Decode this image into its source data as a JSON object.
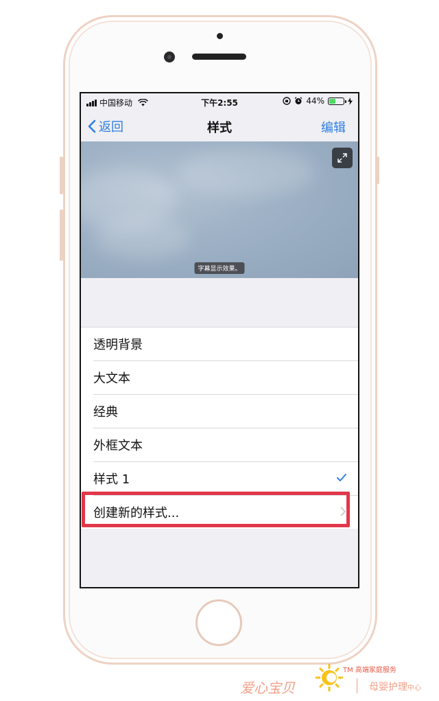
{
  "status_bar": {
    "carrier": "中国移动",
    "time": "下午2:55",
    "battery_percent": "44%",
    "battery_level": 0.44,
    "icons": [
      "signal-icon",
      "wifi-icon",
      "orientation-lock-icon",
      "alarm-icon",
      "battery-icon",
      "charging-icon"
    ]
  },
  "nav": {
    "back_label": "返回",
    "title": "样式",
    "edit_label": "编辑"
  },
  "preview": {
    "caption": "字幕显示效果。",
    "expand_icon": "expand-icon"
  },
  "style_list": {
    "items": [
      {
        "label": "透明背景",
        "selected": false
      },
      {
        "label": "大文本",
        "selected": false
      },
      {
        "label": "经典",
        "selected": false
      },
      {
        "label": "外框文本",
        "selected": false
      },
      {
        "label": "样式 1",
        "selected": true
      },
      {
        "label": "创建新的样式...",
        "selected": false,
        "disclosure": true
      }
    ]
  },
  "colors": {
    "accent": "#2f7fe0",
    "highlight": "#e2374a",
    "checkmark": "#2f7fe0"
  },
  "watermark": {
    "brand": "爱心宝贝",
    "tm_line": "TM 高端家庭服务",
    "sub_main": "母婴护理",
    "sub_small": "中心"
  }
}
